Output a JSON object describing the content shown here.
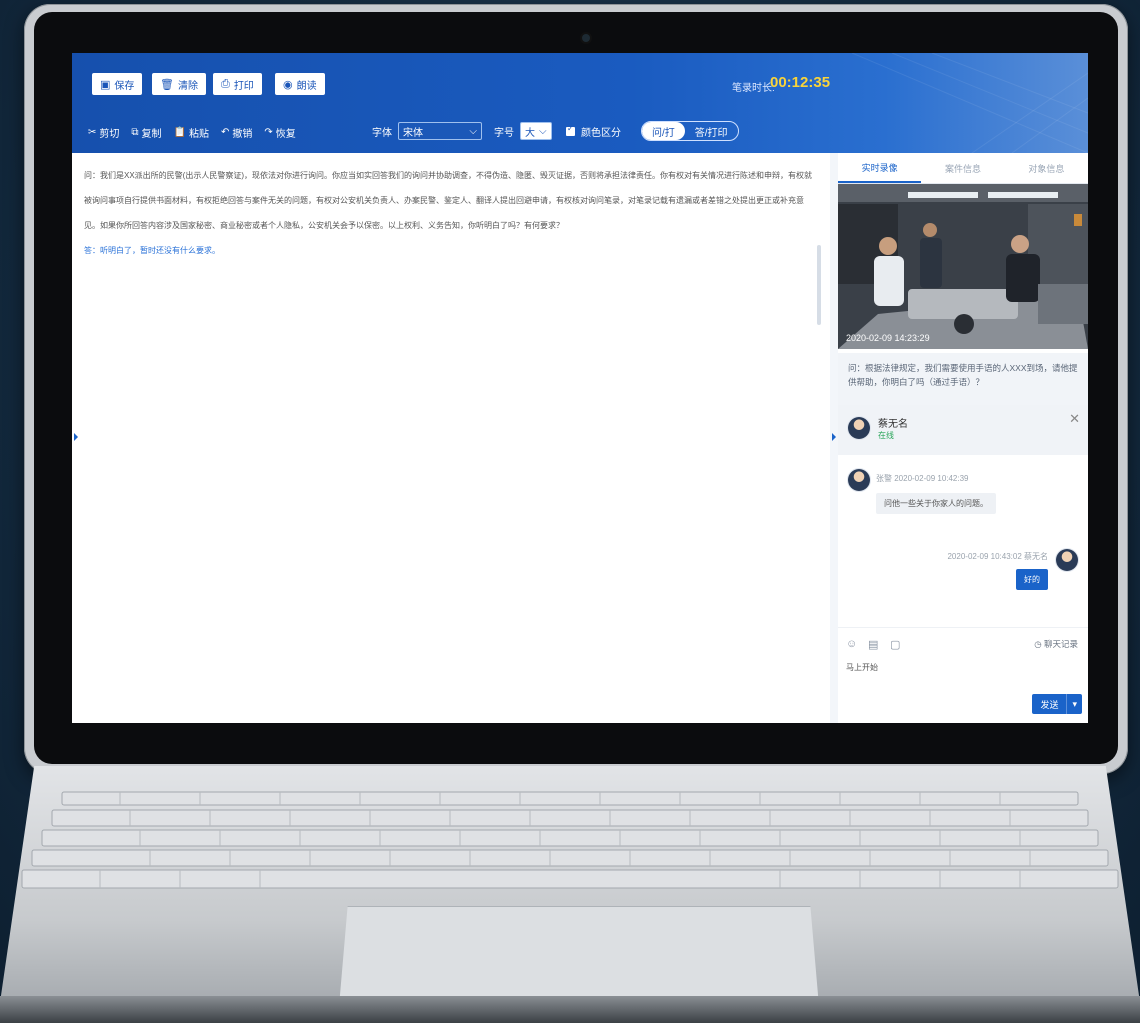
{
  "toolbar_top": {
    "save_label": "保存",
    "clear_label": "清除",
    "print_label": "打印",
    "extra_label": "朗读"
  },
  "session": {
    "timer_label": "笔录时长:",
    "timer_value": "00:12:35"
  },
  "edit_toolbar": {
    "cut": "剪切",
    "copy": "复制",
    "paste": "粘贴",
    "undo": "撤销",
    "redo": "恢复"
  },
  "font": {
    "font_label": "字体",
    "font_value": "宋体",
    "size_label": "字号",
    "size_value": "大",
    "color_distinguish": "颜色区分",
    "toggle_on": "问/打",
    "toggle_off": "答/打印"
  },
  "document": {
    "question": "问：我们是XX派出所的民警(出示人民警察证)，现依法对你进行询问。你应当如实回答我们的询问并协助调查，不得伪造、隐匿、毁灭证据，否则将承担法律责任。你有权对有关情况进行陈述和申辩，有权就被询问事项自行提供书面材料，有权拒绝回答与案件无关的问题，有权对公安机关负责人、办案民警、鉴定人、翻译人提出回避申请，有权核对询问笔录，对笔录记载有遗漏或者差错之处提出更正或补充意见。如果你所回答内容涉及国家秘密、商业秘密或者个人隐私，公安机关会予以保密。以上权利、义务告知，你听明白了吗？有何要求？",
    "answer": "答：听明白了，暂时还没有什么要求。"
  },
  "right_panel": {
    "tabs": [
      "实时录像",
      "案件信息",
      "对象信息"
    ],
    "video_timestamp": "2020-02-09 14:23:29",
    "question_text": "问：根据法律规定，我们需要使用手语的人XXX到场，请他提供帮助，你明白了吗（通过手语）？",
    "contact": {
      "name": "蔡无名",
      "status": "在线"
    },
    "messages": [
      {
        "meta": "张警 2020-02-09 10:42:39",
        "text": "问他一些关于你家人的问题。"
      },
      {
        "meta": "2020-02-09 10:43:02 蔡无名",
        "text": "好的"
      }
    ],
    "history_label": "聊天记录",
    "input_text": "马上开始",
    "send_label": "发送"
  },
  "icons": {
    "save": "save-icon",
    "clear": "trash-icon",
    "print": "printer-icon",
    "read": "speaker-icon",
    "cut": "scissors-icon",
    "copy": "copy-icon",
    "paste": "clipboard-icon",
    "undo": "undo-icon",
    "redo": "redo-icon",
    "emoji": "emoji-icon",
    "image": "image-icon",
    "file": "file-icon",
    "history": "history-icon",
    "close": "close-icon"
  },
  "colors": {
    "primary": "#1a63c9",
    "header_start": "#1650ad",
    "timer": "#f9d43a",
    "answer": "#2a72d8"
  }
}
